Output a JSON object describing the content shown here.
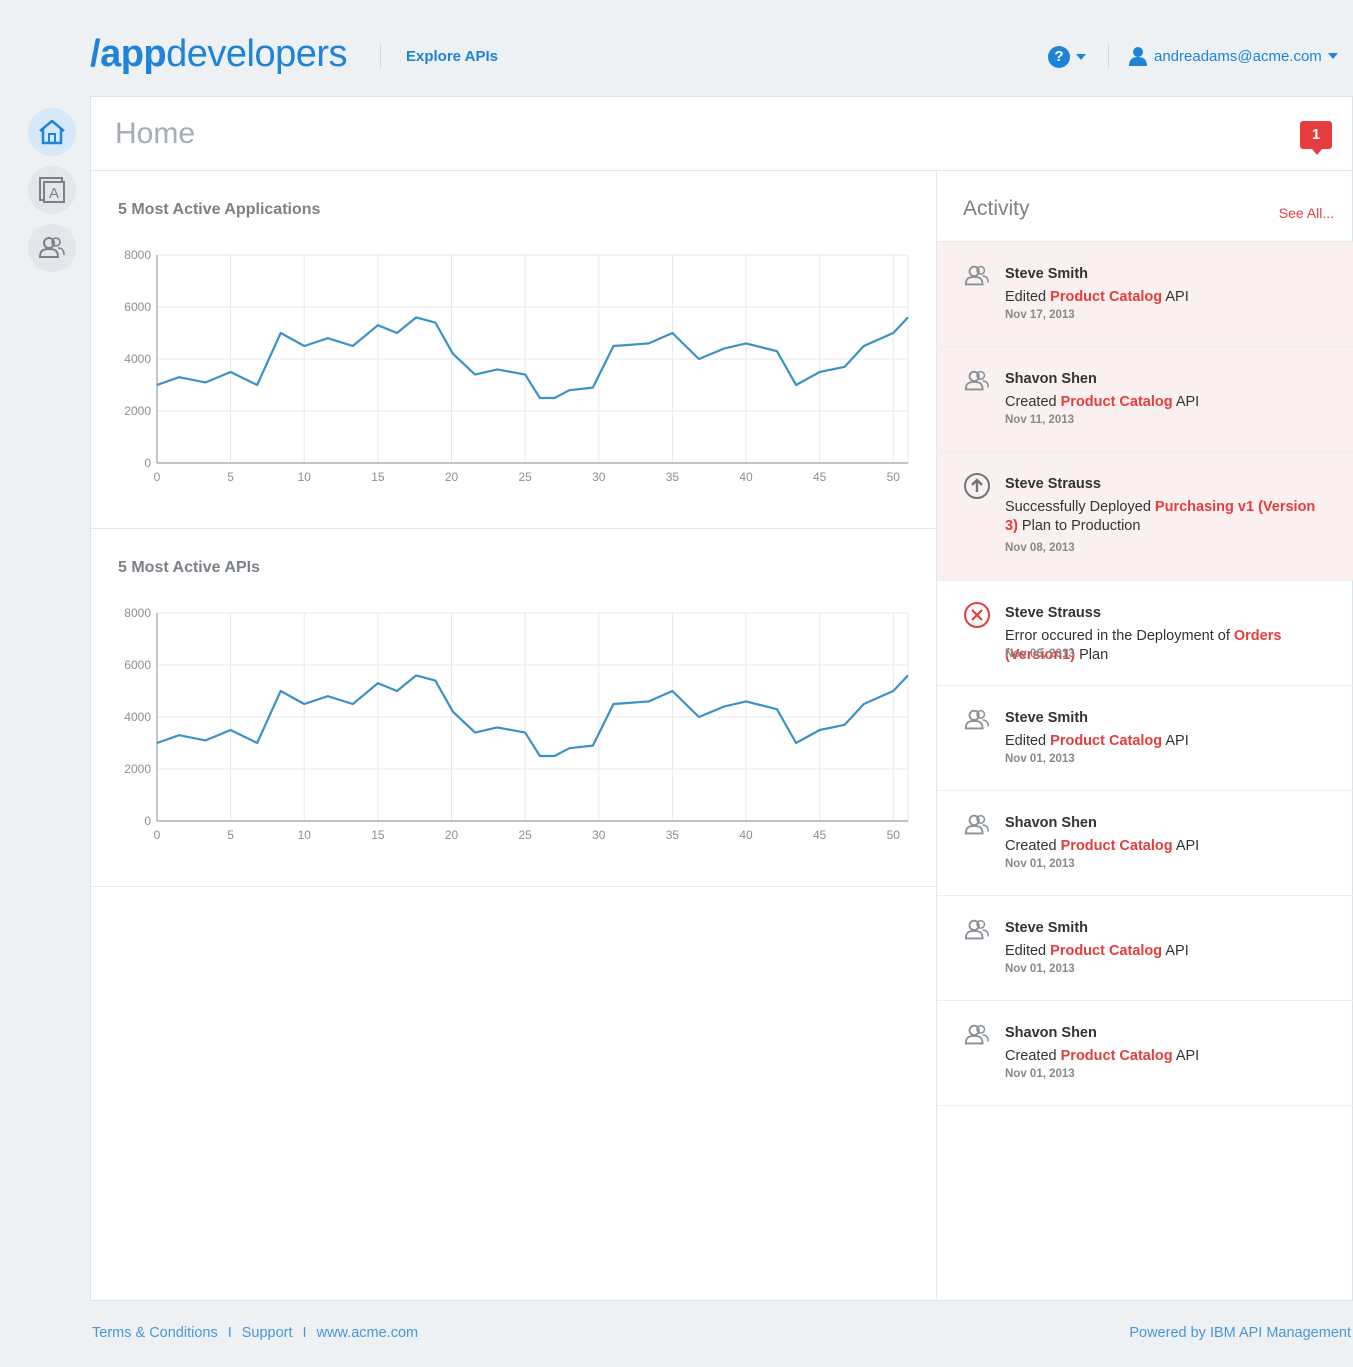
{
  "header": {
    "logo_slash": "/",
    "logo_bold": "app",
    "logo_light": "developers",
    "explore_label": "Explore APIs",
    "help_label": "?",
    "user_email": "andreadams@acme.com"
  },
  "rail": {
    "items": [
      {
        "name": "home",
        "icon": "home-icon",
        "active": true
      },
      {
        "name": "apps",
        "icon": "app-icon",
        "active": false
      },
      {
        "name": "users",
        "icon": "users-icon",
        "active": false
      }
    ]
  },
  "page": {
    "title": "Home",
    "notification_count": "1"
  },
  "colors": {
    "accent": "#1f83d9",
    "alert": "#e53d3d",
    "line": "#3b92c4"
  },
  "chart_data": [
    {
      "type": "line",
      "title": "5 Most Active Applications",
      "xlabel": "",
      "ylabel": "",
      "xlim": [
        0,
        51
      ],
      "ylim": [
        0,
        8000
      ],
      "x_ticks": [
        0,
        5,
        10,
        15,
        20,
        25,
        30,
        35,
        40,
        45,
        50
      ],
      "y_ticks": [
        0,
        2000,
        4000,
        6000,
        8000
      ],
      "grid": true,
      "x": [
        0,
        1.5,
        3.3,
        5,
        6.8,
        8.4,
        10,
        11.6,
        13.3,
        15,
        16.3,
        17.6,
        18.9,
        20.1,
        21.6,
        23.1,
        25,
        26,
        27,
        28,
        29.6,
        31,
        33.4,
        35,
        36.8,
        38.5,
        40,
        42.1,
        43.4,
        45,
        46.7,
        48,
        50,
        51
      ],
      "series": [
        {
          "values": [
            3000,
            3300,
            3100,
            3500,
            3000,
            5000,
            4500,
            4800,
            4500,
            5300,
            5000,
            5600,
            5400,
            4200,
            3400,
            3600,
            3400,
            2500,
            2500,
            2800,
            2900,
            4500,
            4600,
            5000,
            4000,
            4400,
            4600,
            4300,
            3000,
            3500,
            3700,
            4500,
            5000,
            5600
          ]
        }
      ]
    },
    {
      "type": "line",
      "title": "5 Most Active APIs",
      "xlabel": "",
      "ylabel": "",
      "xlim": [
        0,
        51
      ],
      "ylim": [
        0,
        8000
      ],
      "x_ticks": [
        0,
        5,
        10,
        15,
        20,
        25,
        30,
        35,
        40,
        45,
        50
      ],
      "y_ticks": [
        0,
        2000,
        4000,
        6000,
        8000
      ],
      "grid": true,
      "x": [
        0,
        1.5,
        3.3,
        5,
        6.8,
        8.4,
        10,
        11.6,
        13.3,
        15,
        16.3,
        17.6,
        18.9,
        20.1,
        21.6,
        23.1,
        25,
        26,
        27,
        28,
        29.6,
        31,
        33.4,
        35,
        36.8,
        38.5,
        40,
        42.1,
        43.4,
        45,
        46.7,
        48,
        50,
        51
      ],
      "series": [
        {
          "values": [
            3000,
            3300,
            3100,
            3500,
            3000,
            5000,
            4500,
            4800,
            4500,
            5300,
            5000,
            5600,
            5400,
            4200,
            3400,
            3600,
            3400,
            2500,
            2500,
            2800,
            2900,
            4500,
            4600,
            5000,
            4000,
            4400,
            4600,
            4300,
            3000,
            3500,
            3700,
            4500,
            5000,
            5600
          ]
        }
      ]
    }
  ],
  "activity": {
    "title": "Activity",
    "see_all": "See All...",
    "items": [
      {
        "icon": "users-icon",
        "highlight": true,
        "name": "Steve Smith",
        "pre": "Edited ",
        "link": "Product Catalog",
        "post": " API",
        "date": "Nov 17, 2013"
      },
      {
        "icon": "users-icon",
        "highlight": true,
        "name": "Shavon Shen",
        "pre": "Created ",
        "link": "Product Catalog",
        "post": " API",
        "date": "Nov 11, 2013"
      },
      {
        "icon": "upload-icon",
        "highlight": true,
        "name": "Steve Strauss",
        "pre": "Successfully Deployed ",
        "link": "Purchasing v1 (Version 3)",
        "post": " Plan to Production",
        "date": "Nov 08, 2013"
      },
      {
        "icon": "error-icon",
        "highlight": false,
        "name": "Steve Strauss",
        "pre": "Error occured in the Deployment of ",
        "link": "Orders (Version1)",
        "post": " Plan",
        "date": "Nov 06, 2013"
      },
      {
        "icon": "users-icon",
        "highlight": false,
        "name": "Steve Smith",
        "pre": "Edited ",
        "link": "Product Catalog",
        "post": " API",
        "date": "Nov 01, 2013"
      },
      {
        "icon": "users-icon",
        "highlight": false,
        "name": "Shavon Shen",
        "pre": "Created ",
        "link": "Product Catalog",
        "post": " API",
        "date": "Nov 01, 2013"
      },
      {
        "icon": "users-icon",
        "highlight": false,
        "name": "Steve Smith",
        "pre": "Edited ",
        "link": "Product Catalog",
        "post": " API",
        "date": "Nov 01, 2013"
      },
      {
        "icon": "users-icon",
        "highlight": false,
        "name": "Shavon Shen",
        "pre": "Created ",
        "link": "Product Catalog",
        "post": " API",
        "date": "Nov 01, 2013"
      }
    ]
  },
  "footer": {
    "terms": "Terms & Conditions",
    "sep": "I",
    "support": "Support",
    "site": "www.acme.com",
    "powered": "Powered by IBM API Management"
  }
}
